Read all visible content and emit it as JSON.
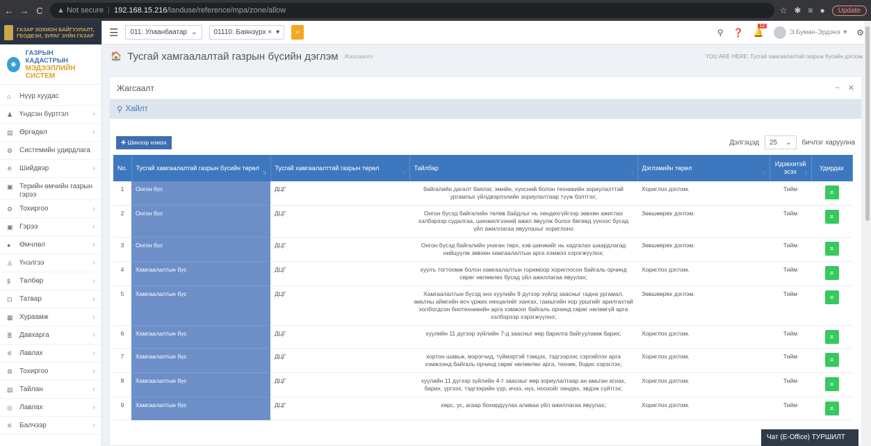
{
  "browser": {
    "back": "←",
    "forward": "→",
    "reload": "C",
    "security": "▲ Not secure",
    "url_host": "192.168.15.216",
    "url_path": "/landuse/reference/mpa/zone/allow",
    "update": "Update"
  },
  "org": {
    "line1": "ГАЗАР ЗОХИОН БАЙГУУЛАЛТ,",
    "line2": "ГЕОДЕЗИ, ЗУРАГ ЗҮЙН ГАЗАР"
  },
  "system": {
    "line1": "ГАЗРЫН КАДАСТРЫН",
    "line2": "МЭДЭЭЛЛИЙН СИСТЕМ"
  },
  "sidebar": {
    "items": [
      {
        "icon": "home",
        "label": "Нүүр хуудас",
        "has_children": false
      },
      {
        "icon": "user",
        "label": "Үндсэн бүртгэл",
        "has_children": true
      },
      {
        "icon": "doc",
        "label": "Өргөдөл",
        "has_children": true
      },
      {
        "icon": "gear",
        "label": "Системийн удирдлага",
        "has_children": false
      },
      {
        "icon": "decision",
        "label": "Шийдвэр",
        "has_children": true
      },
      {
        "icon": "card",
        "label": "Терийн өмчийн газрын гэрээ",
        "has_children": false
      },
      {
        "icon": "gear",
        "label": "Тохиргоо",
        "has_children": true
      },
      {
        "icon": "card",
        "label": "Гэрээ",
        "has_children": true
      },
      {
        "icon": "dot",
        "label": "Өмчлөл",
        "has_children": true
      },
      {
        "icon": "person",
        "label": "Үнэлгээ",
        "has_children": true
      },
      {
        "icon": "dollar",
        "label": "Төлбөр",
        "has_children": true
      },
      {
        "icon": "tax",
        "label": "Татвар",
        "has_children": true
      },
      {
        "icon": "grid",
        "label": "Хураамж",
        "has_children": true
      },
      {
        "icon": "list",
        "label": "Давхарга",
        "has_children": true
      },
      {
        "icon": "decision",
        "label": "Лавлах",
        "has_children": true
      },
      {
        "icon": "gear",
        "label": "Тохиргоо",
        "has_children": true
      },
      {
        "icon": "doc",
        "label": "Тайлан",
        "has_children": true
      },
      {
        "icon": "circle",
        "label": "Лавлах",
        "has_children": true
      },
      {
        "icon": "decision",
        "label": "Балчээр",
        "has_children": true
      }
    ]
  },
  "topbar": {
    "select1": "011: Улаанбаатар",
    "select2": "01110: Баянзүрх ×",
    "notif_count": "12",
    "user": "Э.Буман-Эрдэнэ"
  },
  "page": {
    "title": "Тусгай хамгаалалтай газрын бүсийн дэглэм",
    "subtitle": "Жагсаалт",
    "breadcrumb": "YOU ARE HERE:  Тусгай хамгаалалтай газрын бүсийн дэглэм"
  },
  "portlet": {
    "title": "Жагсаалт",
    "search": "Хайлт",
    "add_button": "Шинээр нэмэх",
    "length_prefix": "Дэлгэцэд",
    "length_value": "25",
    "length_suffix": "бичлэг харуулна"
  },
  "table": {
    "columns": [
      "No.",
      "Тусгай хамгаалалтай газрын бүсийн төрөл",
      "Тусгай хамгаалалттай газрын төрөл",
      "Тайлбар",
      "Дэглэмийн төрөл",
      "Идэвхитэй эсэх",
      "Удирдах"
    ],
    "rows": [
      {
        "no": "1",
        "zone": "Онгон бүс",
        "type": "ДЦГ",
        "desc": "байгалийн дагалт баялаг, эмийн, хүнсний болон техникийн зориулалттай ургамлыг үйлдвэрлэлийн зориулалтаар түүж бэлтгэх;",
        "regime": "Хориглох дэглэм.",
        "active": "Тийм"
      },
      {
        "no": "2",
        "zone": "Онгон бүс",
        "type": "ДЦГ",
        "desc": "Онгон бүсэд байгалийн төлөв байдлыг нь хөндөхгүйгээр зөвхөн ажиглах хэлбэрээр судалгаа, шинжилгээний ажил явуулж болох бөгөөд үүнээс бусад үйл ажиллагаа явуулахыг хориглоно",
        "regime": "Зөвшөөрөх дэглэм.",
        "active": "Тийм"
      },
      {
        "no": "3",
        "zone": "Онгон бүс",
        "type": "ДЦГ",
        "desc": "Онгон бүсэд байгалийн унаган төрх, хэв шинжийг нь хадгалах шаардлагад нийцүүлж зөвхөн хамгаалалтын арга хэмжээ хэрэгжүүлнэ;",
        "regime": "Зөвшөөрөх дэглэм.",
        "active": "Тийм"
      },
      {
        "no": "4",
        "zone": "Хамгаалалтын бүс",
        "type": "ДЦГ",
        "desc": "хуулъ тогтоомж болон хамгаалалтын горимоор хориглосон байгаль орчинд сөрөг нөлөөлөх бусад үйл ажиллагаа явуулах;",
        "regime": "Хориглох дэглэм.",
        "active": "Тийм"
      },
      {
        "no": "5",
        "zone": "Хамгаалалтын бүс",
        "type": "ДЦГ",
        "desc": "Хамгаалалтын бүсэд энэ хуулийн 9 дүгээр зүйлд заасныг гадна ургамал, амьтны аймгийн өсч үржих нөхцөлийг хангах, гамшгийн хор уршгийг арилгахтай холбогдсон биотехникийн арга хэмжээг байгаль орчинд сөрөг нөлөөгүй арга хэлбэрээр хэрэгжүүлнэ;",
        "regime": "Зөвшөөрөх дэглэм.",
        "active": "Тийм"
      },
      {
        "no": "6",
        "zone": "Хамгаалалтын бүс",
        "type": "ДЦГ",
        "desc": "хуулийн 11 дүгээр зүйлийн 7-д заасныг өөр барилга байгууламж барих;",
        "regime": "Хориглох дэглэм.",
        "active": "Тийм"
      },
      {
        "no": "7",
        "zone": "Хамгаалалтын бүс",
        "type": "ДЦГ",
        "desc": "хортон шавьж, мэрэгчид, түймэртэй тэмцэх, тэдгээрээс сэргийлэх арга хэмжээнд байгаль орчинд сөрөг нөлөөлөх арга, техник, бодис хэрэглэх;",
        "regime": "Хориглох дэглэм.",
        "active": "Тийм"
      },
      {
        "no": "8",
        "zone": "Хамгаалалтын бүс",
        "type": "ДЦГ",
        "desc": "хуулийн 11 дүгээр зүйлийн 4-т заасныг өөр зориулалтаар ан амьтан агнах, барих, үргээх, тэдгээрийн үүр, ичээ, нүх, ноохойг хөндөх, эвдэж сүйтгэх;",
        "regime": "Хориглох дэглэм.",
        "active": "Тийм"
      },
      {
        "no": "9",
        "zone": "Хамгаалалтын бүс",
        "type": "ДЦГ",
        "desc": "хөрс, ус, агаар бохирдуулах аливаа үйл ажиллагаа явуулах;",
        "regime": "Хориглох дэглэм.",
        "active": "Тийм"
      }
    ]
  },
  "chat": "Чат (E-Office) ТУРШИЛТ",
  "colors": {
    "header_blue": "#3d78bf",
    "zone_cell": "#6c8fc8",
    "edit_green": "#36c95f",
    "accent_orange": "#f5a623"
  }
}
